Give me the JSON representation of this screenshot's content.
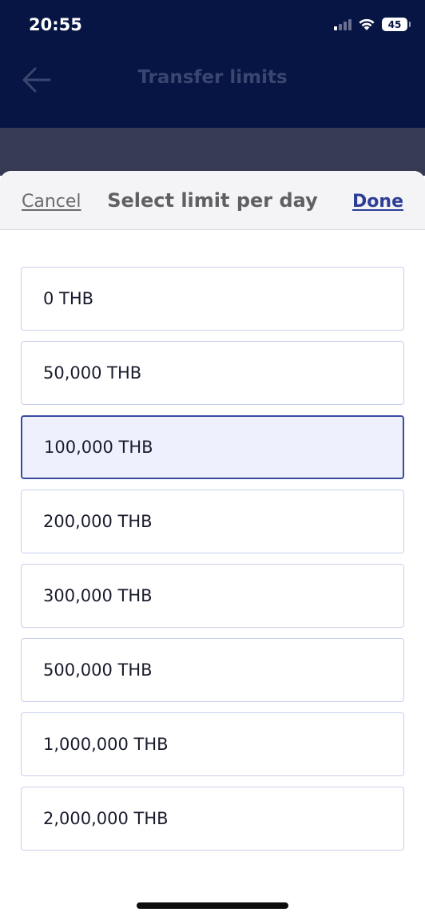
{
  "status_bar": {
    "time": "20:55",
    "battery": "45",
    "icons": [
      "signal-icon",
      "wifi-icon",
      "battery-icon"
    ]
  },
  "background_screen": {
    "title": "Transfer limits",
    "back_icon": "arrow-left-icon",
    "header_color": "#071544"
  },
  "sheet": {
    "cancel_label": "Cancel",
    "title": "Select limit per day",
    "done_label": "Done",
    "selected_value": "100,000 THB",
    "options": [
      {
        "label": "0 THB"
      },
      {
        "label": "50,000 THB"
      },
      {
        "label": "100,000 THB"
      },
      {
        "label": "200,000 THB"
      },
      {
        "label": "300,000 THB"
      },
      {
        "label": "500,000 THB"
      },
      {
        "label": "1,000,000 THB"
      },
      {
        "label": "2,000,000 THB"
      }
    ],
    "accent_color": "#2d3e96",
    "selected_background": "#eef1fd"
  }
}
